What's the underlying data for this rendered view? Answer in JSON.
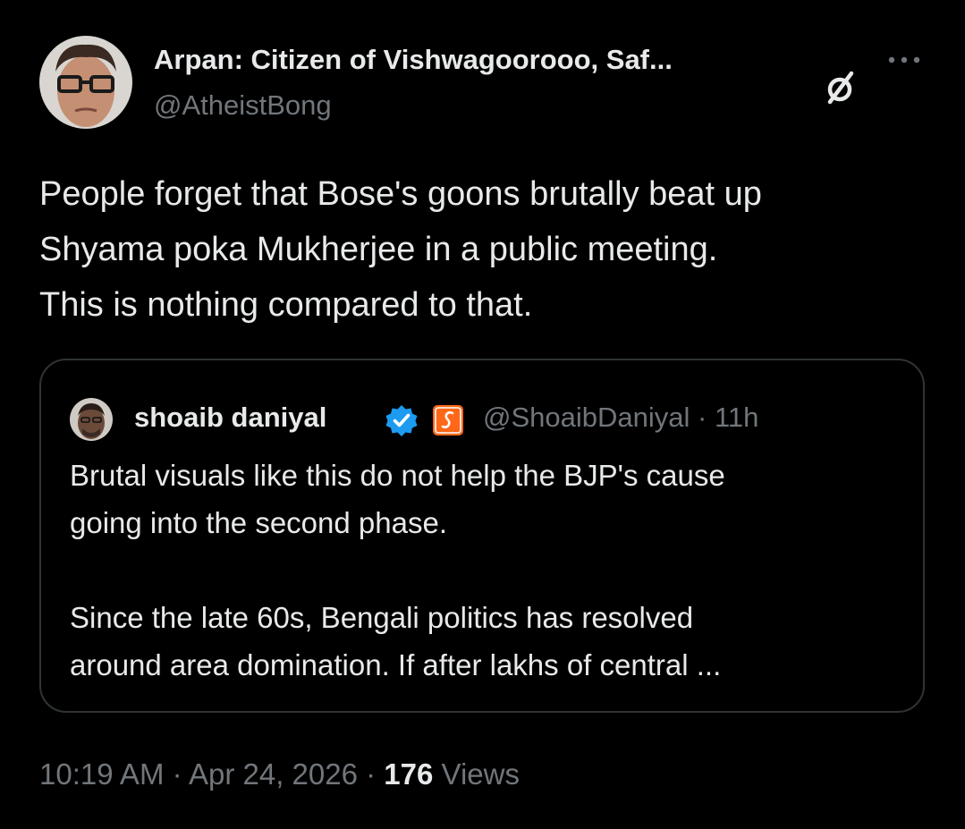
{
  "author": {
    "display_name": "Arpan: Citizen of Vishwagoorooo, Saf...",
    "handle": "@AtheistBong"
  },
  "header_icons": {
    "affiliation": "slashed-circle-icon",
    "more": "more-options-icon"
  },
  "tweet": {
    "lines": [
      "People forget that Bose's goons brutally beat up",
      "Shyama poka Mukherjee in a public meeting.",
      "This is nothing compared to that."
    ]
  },
  "quote": {
    "display_name": "shoaib daniyal",
    "handle": "@ShoaibDaniyal",
    "separator": "·",
    "time": "11h",
    "verified_icon": "verified-badge-icon",
    "verified_color": "#1d9bf0",
    "brand_icon": "substack-icon",
    "brand_color": "#ff6719",
    "text_lines": [
      "Brutal visuals like this do not help the BJP's cause",
      "going into the second phase.",
      "",
      "Since the late 60s, Bengali politics has resolved",
      "around area domination. If after lakhs of central ..."
    ]
  },
  "footer": {
    "time": "10:19 AM",
    "separator": "·",
    "date": "Apr 24, 2026",
    "views_count": "176",
    "views_label": "Views"
  },
  "colors": {
    "background": "#000000",
    "primary_text": "#e7e9ea",
    "secondary_text": "#71767b",
    "border": "#2f3336"
  }
}
